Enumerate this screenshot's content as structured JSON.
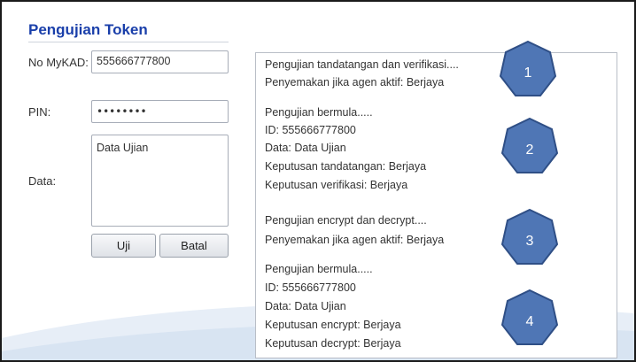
{
  "form": {
    "title": "Pengujian Token",
    "mykad_label": "No MyKAD:",
    "mykad_value": "555666777800",
    "pin_label": "PIN:",
    "pin_value": "••••••••",
    "data_label": "Data:",
    "data_value": "Data Ujian",
    "test_button": "Uji",
    "cancel_button": "Batal"
  },
  "log": {
    "lines": [
      "Pengujian tandatangan dan verifikasi....",
      "Penyemakan jika agen aktif: Berjaya",
      "Pengujian bermula.....",
      "ID: 555666777800",
      "Data: Data Ujian",
      "Keputusan tandatangan: Berjaya",
      "Keputusan verifikasi: Berjaya",
      "Pengujian encrypt dan decrypt....",
      "Penyemakan jika agen aktif: Berjaya",
      "Pengujian bermula.....",
      "ID: 555666777800",
      "Data: Data Ujian",
      "Keputusan encrypt: Berjaya",
      "Keputusan decrypt: Berjaya"
    ]
  },
  "badges": [
    "1",
    "2",
    "3",
    "4"
  ],
  "colors": {
    "title": "#1a3faa",
    "badge_fill": "#4f76b5",
    "badge_stroke": "#2f4f86"
  }
}
